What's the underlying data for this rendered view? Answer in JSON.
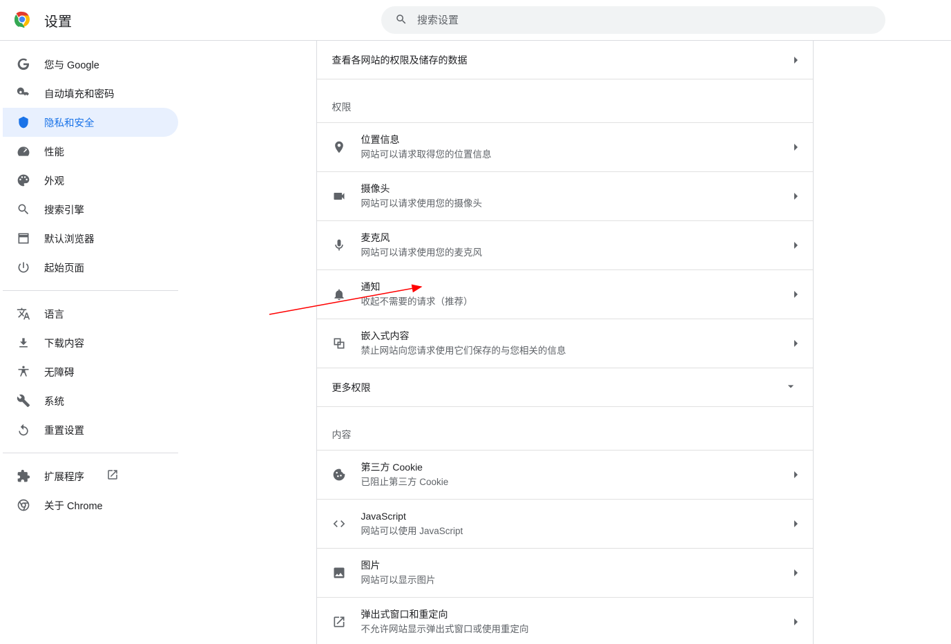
{
  "header": {
    "title": "设置",
    "search_placeholder": "搜索设置"
  },
  "sidebar": {
    "items": [
      {
        "id": "you-and-google",
        "label": "您与 Google"
      },
      {
        "id": "autofill",
        "label": "自动填充和密码"
      },
      {
        "id": "privacy",
        "label": "隐私和安全"
      },
      {
        "id": "performance",
        "label": "性能"
      },
      {
        "id": "appearance",
        "label": "外观"
      },
      {
        "id": "search-engine",
        "label": "搜索引擎"
      },
      {
        "id": "default-browser",
        "label": "默认浏览器"
      },
      {
        "id": "on-startup",
        "label": "起始页面"
      }
    ],
    "items2": [
      {
        "id": "language",
        "label": "语言"
      },
      {
        "id": "downloads",
        "label": "下载内容"
      },
      {
        "id": "accessibility",
        "label": "无障碍"
      },
      {
        "id": "system",
        "label": "系统"
      },
      {
        "id": "reset",
        "label": "重置设置"
      }
    ],
    "items3": [
      {
        "id": "extensions",
        "label": "扩展程序"
      },
      {
        "id": "about",
        "label": "关于 Chrome"
      }
    ]
  },
  "content": {
    "top_row": {
      "title": "查看各网站的权限及储存的数据"
    },
    "section_permissions": "权限",
    "section_content": "内容",
    "more_permissions": "更多权限",
    "permissions": [
      {
        "id": "location",
        "title": "位置信息",
        "sub": "网站可以请求取得您的位置信息"
      },
      {
        "id": "camera",
        "title": "摄像头",
        "sub": "网站可以请求使用您的摄像头"
      },
      {
        "id": "microphone",
        "title": "麦克风",
        "sub": "网站可以请求使用您的麦克风"
      },
      {
        "id": "notifications",
        "title": "通知",
        "sub": "收起不需要的请求（推荐）"
      },
      {
        "id": "embedded",
        "title": "嵌入式内容",
        "sub": "禁止网站向您请求使用它们保存的与您相关的信息"
      }
    ],
    "content_items": [
      {
        "id": "cookies",
        "title": "第三方 Cookie",
        "sub": "已阻止第三方 Cookie"
      },
      {
        "id": "javascript",
        "title": "JavaScript",
        "sub": "网站可以使用 JavaScript"
      },
      {
        "id": "images",
        "title": "图片",
        "sub": "网站可以显示图片"
      },
      {
        "id": "popups",
        "title": "弹出式窗口和重定向",
        "sub": "不允许网站显示弹出式窗口或使用重定向"
      }
    ]
  }
}
